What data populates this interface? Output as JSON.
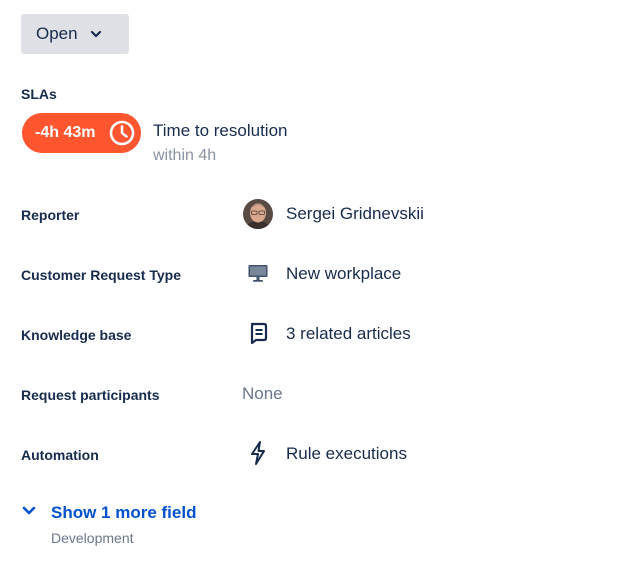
{
  "status": {
    "label": "Open"
  },
  "slas": {
    "section_label": "SLAs",
    "time_remaining": "-4h 43m",
    "title": "Time to resolution",
    "subtitle": "within 4h",
    "pill_color": "#ff5630"
  },
  "fields": {
    "reporter": {
      "label": "Reporter",
      "value": "Sergei Gridnevskii"
    },
    "request_type": {
      "label": "Customer Request Type",
      "value": "New workplace",
      "icon": "monitor-icon"
    },
    "knowledge_base": {
      "label": "Knowledge base",
      "value": "3 related articles",
      "icon": "book-icon"
    },
    "participants": {
      "label": "Request participants",
      "value": "None"
    },
    "automation": {
      "label": "Automation",
      "value": "Rule executions",
      "icon": "lightning-icon"
    }
  },
  "more": {
    "label": "Show 1 more field",
    "sub": "Development",
    "link_color": "#0052cc"
  }
}
